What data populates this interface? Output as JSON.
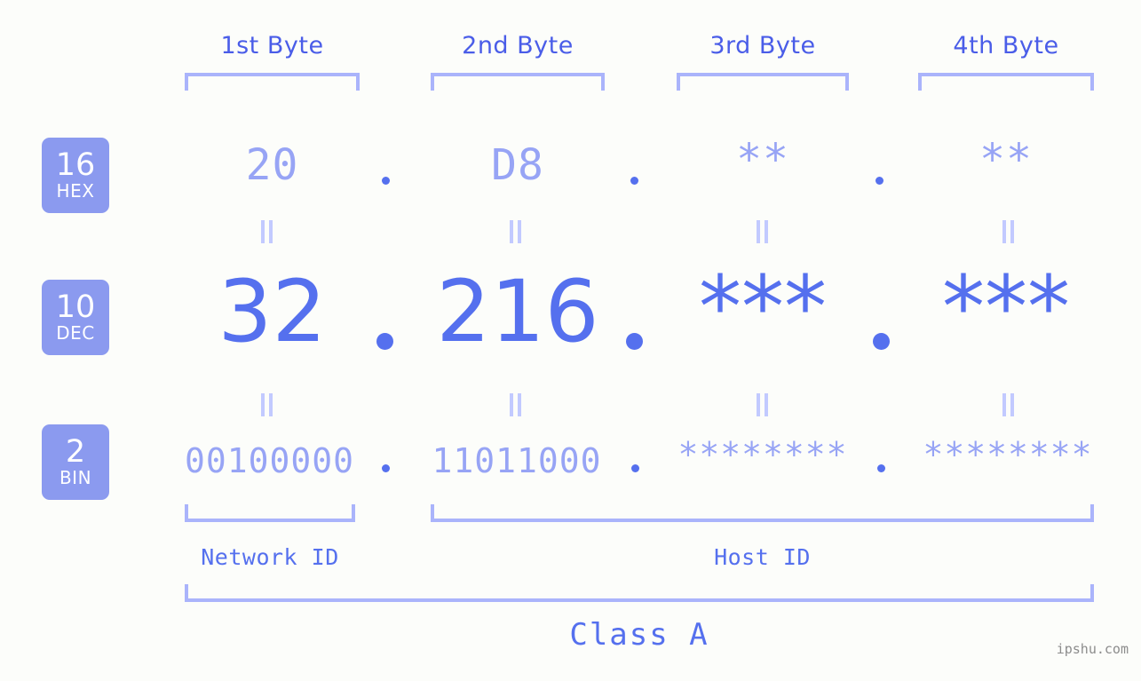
{
  "page": {
    "background": "#fcfdfa",
    "accent_dark": "#5570ee",
    "accent_mid": "#4a5de8",
    "accent_light": "#97a4f5",
    "bracket_color": "#aab4fb",
    "badge_bg": "#8b9aef",
    "watermark": "ipshu.com"
  },
  "byte_headers": [
    {
      "label": "1st Byte"
    },
    {
      "label": "2nd Byte"
    },
    {
      "label": "3rd Byte"
    },
    {
      "label": "4th Byte"
    }
  ],
  "rows": [
    {
      "badge_number": "16",
      "badge_name": "HEX",
      "values": [
        "20",
        "D8",
        "**",
        "**"
      ],
      "separators": [
        ".",
        ".",
        "."
      ]
    },
    {
      "badge_number": "10",
      "badge_name": "DEC",
      "values": [
        "32",
        "216",
        "***",
        "***"
      ],
      "separators": [
        ".",
        ".",
        "."
      ]
    },
    {
      "badge_number": "2",
      "badge_name": "BIN",
      "values": [
        "00100000",
        "11011000",
        "********",
        "********"
      ],
      "separators": [
        ".",
        ".",
        "."
      ]
    }
  ],
  "equivalence_marks": {
    "glyph": "=",
    "count_per_gap": 4
  },
  "segments": [
    {
      "label": "Network ID"
    },
    {
      "label": "Host ID"
    }
  ],
  "class": {
    "label": "Class A"
  }
}
